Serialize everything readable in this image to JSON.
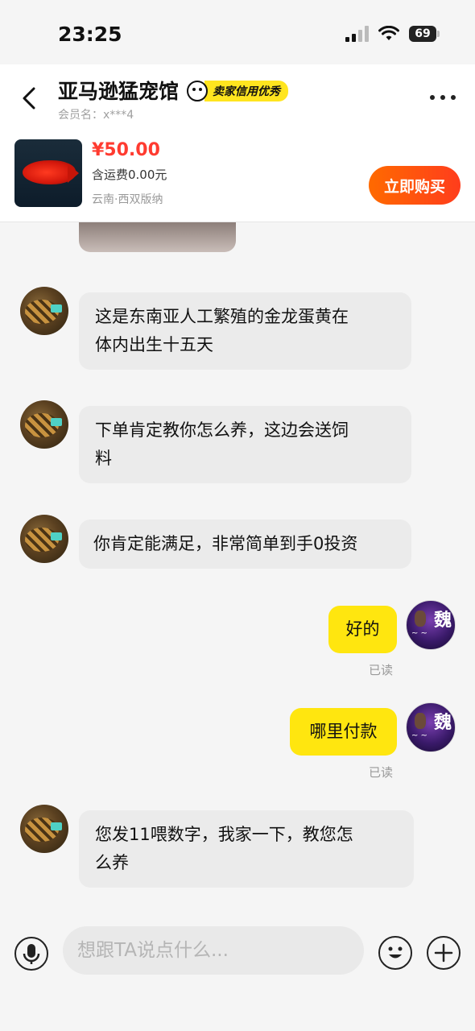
{
  "status_bar": {
    "time": "23:25",
    "battery": "69"
  },
  "header": {
    "shop_name": "亚马逊猛宠馆",
    "credit_badge": "卖家信用优秀",
    "member_label": "会员名：x***4"
  },
  "product": {
    "price": "¥50.00",
    "shipping": "含运费0.00元",
    "location": "云南·西双版纳",
    "buy_label": "立即购买"
  },
  "messages": [
    {
      "side": "left",
      "line1": "这是东南亚人工繁殖的金龙蛋黄在",
      "line2": "体内出生十五天"
    },
    {
      "side": "left",
      "line1": "下单肯定教你怎么养，这边会送饲",
      "line2": "料"
    },
    {
      "side": "left",
      "line1": "你肯定能满足，非常简单到手0投资"
    },
    {
      "side": "right",
      "line1": "好的",
      "status": "已读"
    },
    {
      "side": "right",
      "line1": "哪里付款",
      "status": "已读"
    },
    {
      "side": "left",
      "line1": "您发11喂数字，我家一下，教您怎",
      "line2": "么养"
    }
  ],
  "avatar_right": {
    "glyph": "魏"
  },
  "input": {
    "placeholder": "想跟TA说点什么..."
  }
}
